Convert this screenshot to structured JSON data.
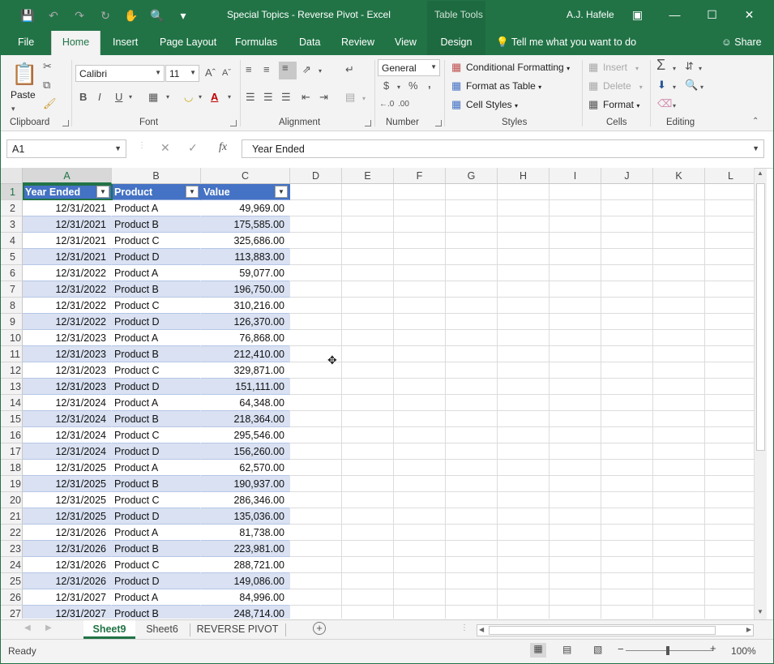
{
  "titlebar": {
    "title": "Special Topics - Reverse Pivot  -  Excel",
    "context_label": "Table Tools",
    "user": "A.J. Hafele"
  },
  "colors": {
    "brand": "#217346",
    "table_header": "#4472c4",
    "table_band": "#d9e1f2"
  },
  "menu": {
    "tabs": [
      "File",
      "Home",
      "Insert",
      "Page Layout",
      "Formulas",
      "Data",
      "Review",
      "View",
      "Design"
    ],
    "active": "Home",
    "tell_me": "Tell me what you want to do",
    "share": "Share"
  },
  "ribbon": {
    "clipboard": {
      "paste": "Paste",
      "label": "Clipboard"
    },
    "font": {
      "family": "Calibri",
      "size": "11",
      "label": "Font"
    },
    "alignment": {
      "label": "Alignment"
    },
    "number": {
      "format": "General",
      "label": "Number"
    },
    "styles": {
      "conditional": "Conditional Formatting",
      "format_table": "Format as Table",
      "cell_styles": "Cell Styles",
      "label": "Styles"
    },
    "cells": {
      "insert": "Insert",
      "delete": "Delete",
      "format": "Format",
      "label": "Cells"
    },
    "editing": {
      "label": "Editing"
    }
  },
  "formula_bar": {
    "name_box": "A1",
    "fx": "fx",
    "value": "Year Ended"
  },
  "grid": {
    "columns": [
      "A",
      "B",
      "C",
      "D",
      "E",
      "F",
      "G",
      "H",
      "I",
      "J",
      "K",
      "L"
    ],
    "header_row": [
      "Year Ended",
      "Product",
      "Value"
    ],
    "rows": [
      {
        "n": "1"
      },
      {
        "n": "2",
        "a": "12/31/2021",
        "b": "Product A",
        "c": "49,969.00"
      },
      {
        "n": "3",
        "a": "12/31/2021",
        "b": "Product B",
        "c": "175,585.00"
      },
      {
        "n": "4",
        "a": "12/31/2021",
        "b": "Product C",
        "c": "325,686.00"
      },
      {
        "n": "5",
        "a": "12/31/2021",
        "b": "Product D",
        "c": "113,883.00"
      },
      {
        "n": "6",
        "a": "12/31/2022",
        "b": "Product A",
        "c": "59,077.00"
      },
      {
        "n": "7",
        "a": "12/31/2022",
        "b": "Product B",
        "c": "196,750.00"
      },
      {
        "n": "8",
        "a": "12/31/2022",
        "b": "Product C",
        "c": "310,216.00"
      },
      {
        "n": "9",
        "a": "12/31/2022",
        "b": "Product D",
        "c": "126,370.00"
      },
      {
        "n": "10",
        "a": "12/31/2023",
        "b": "Product A",
        "c": "76,868.00"
      },
      {
        "n": "11",
        "a": "12/31/2023",
        "b": "Product B",
        "c": "212,410.00"
      },
      {
        "n": "12",
        "a": "12/31/2023",
        "b": "Product C",
        "c": "329,871.00"
      },
      {
        "n": "13",
        "a": "12/31/2023",
        "b": "Product D",
        "c": "151,111.00"
      },
      {
        "n": "14",
        "a": "12/31/2024",
        "b": "Product A",
        "c": "64,348.00"
      },
      {
        "n": "15",
        "a": "12/31/2024",
        "b": "Product B",
        "c": "218,364.00"
      },
      {
        "n": "16",
        "a": "12/31/2024",
        "b": "Product C",
        "c": "295,546.00"
      },
      {
        "n": "17",
        "a": "12/31/2024",
        "b": "Product D",
        "c": "156,260.00"
      },
      {
        "n": "18",
        "a": "12/31/2025",
        "b": "Product A",
        "c": "62,570.00"
      },
      {
        "n": "19",
        "a": "12/31/2025",
        "b": "Product B",
        "c": "190,937.00"
      },
      {
        "n": "20",
        "a": "12/31/2025",
        "b": "Product C",
        "c": "286,346.00"
      },
      {
        "n": "21",
        "a": "12/31/2025",
        "b": "Product D",
        "c": "135,036.00"
      },
      {
        "n": "22",
        "a": "12/31/2026",
        "b": "Product A",
        "c": "81,738.00"
      },
      {
        "n": "23",
        "a": "12/31/2026",
        "b": "Product B",
        "c": "223,981.00"
      },
      {
        "n": "24",
        "a": "12/31/2026",
        "b": "Product C",
        "c": "288,721.00"
      },
      {
        "n": "25",
        "a": "12/31/2026",
        "b": "Product D",
        "c": "149,086.00"
      },
      {
        "n": "26",
        "a": "12/31/2027",
        "b": "Product A",
        "c": "84,996.00"
      },
      {
        "n": "27",
        "a": "12/31/2027",
        "b": "Product B",
        "c": "248,714.00"
      }
    ]
  },
  "sheets": {
    "tabs": [
      "Sheet9",
      "Sheet6",
      "REVERSE PIVOT"
    ],
    "active": "Sheet9"
  },
  "status": {
    "ready": "Ready",
    "zoom": "100%"
  }
}
